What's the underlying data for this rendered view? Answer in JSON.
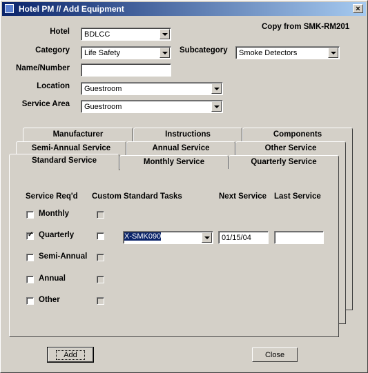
{
  "window": {
    "title": "Hotel PM // Add Equipment",
    "close_label": "×"
  },
  "copy_from": "Copy from SMK-RM201",
  "form": {
    "hotel_label": "Hotel",
    "hotel_value": "BDLCC",
    "category_label": "Category",
    "category_value": "Life Safety",
    "subcategory_label": "Subcategory",
    "subcategory_value": "Smoke Detectors",
    "name_label": "Name/Number",
    "name_value": "",
    "location_label": "Location",
    "location_value": "Guestroom",
    "service_area_label": "Service Area",
    "service_area_value": "Guestroom"
  },
  "tabs": {
    "row1": [
      "Manufacturer",
      "Instructions",
      "Components"
    ],
    "row2": [
      "Semi-Annual Service",
      "Annual Service",
      "Other Service"
    ],
    "row3": [
      "Standard Service",
      "Monthly Service",
      "Quarterly Service"
    ]
  },
  "service": {
    "headers": {
      "service_reqd": "Service Req'd",
      "custom_tasks": "Custom Standard Tasks",
      "next_service": "Next Service",
      "last_service": "Last Service"
    },
    "rows": [
      {
        "label": "Monthly",
        "checked": false
      },
      {
        "label": "Quarterly",
        "checked": true,
        "task": "X-SMK090",
        "next": "01/15/04",
        "last": ""
      },
      {
        "label": "Semi-Annual",
        "checked": false
      },
      {
        "label": "Annual",
        "checked": false
      },
      {
        "label": "Other",
        "checked": false
      }
    ]
  },
  "buttons": {
    "add": "Add",
    "close": "Close"
  }
}
